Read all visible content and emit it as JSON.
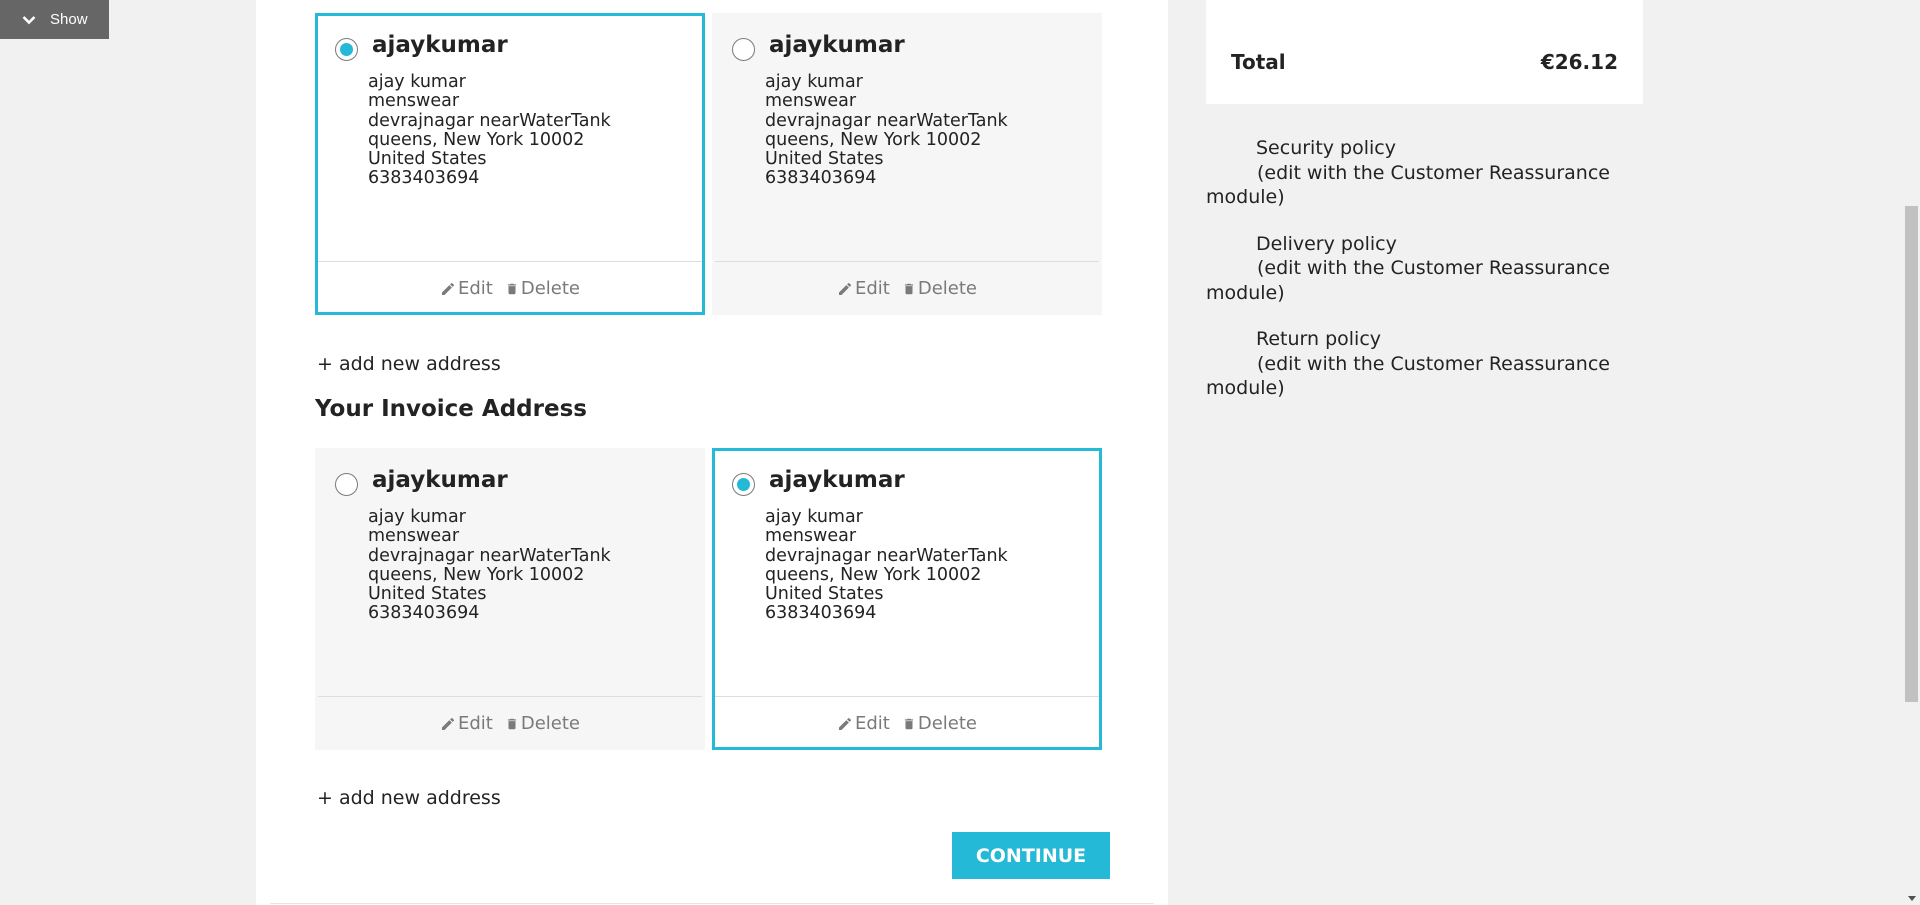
{
  "toggle": {
    "label": "Show"
  },
  "delivery_addresses": [
    {
      "alias": "ajaykumar",
      "selected": true,
      "lines": [
        "ajay kumar",
        "menswear",
        "devrajnagar nearWaterTank",
        "queens, New York 10002",
        "United States",
        "6383403694"
      ],
      "edit_label": "Edit",
      "delete_label": "Delete"
    },
    {
      "alias": "ajaykumar",
      "selected": false,
      "lines": [
        "ajay kumar",
        "menswear",
        "devrajnagar nearWaterTank",
        "queens, New York 10002",
        "United States",
        "6383403694"
      ],
      "edit_label": "Edit",
      "delete_label": "Delete"
    }
  ],
  "add_new_address_label": "+ add new address",
  "invoice_section_title": "Your Invoice Address",
  "invoice_addresses": [
    {
      "alias": "ajaykumar",
      "selected": false,
      "lines": [
        "ajay kumar",
        "menswear",
        "devrajnagar nearWaterTank",
        "queens, New York 10002",
        "United States",
        "6383403694"
      ],
      "edit_label": "Edit",
      "delete_label": "Delete"
    },
    {
      "alias": "ajaykumar",
      "selected": true,
      "lines": [
        "ajay kumar",
        "menswear",
        "devrajnagar nearWaterTank",
        "queens, New York 10002",
        "United States",
        "6383403694"
      ],
      "edit_label": "Edit",
      "delete_label": "Delete"
    }
  ],
  "continue_label": "CONTINUE",
  "summary": {
    "total_label": "Total",
    "total_value": "€26.12"
  },
  "reassurance": [
    {
      "title": "Security policy",
      "sub": "(edit with the Customer Reassurance module)"
    },
    {
      "title": "Delivery policy",
      "sub": "(edit with the Customer Reassurance module)"
    },
    {
      "title": "Return policy",
      "sub": "(edit with the Customer Reassurance module)"
    }
  ],
  "colors": {
    "accent": "#24b9d7",
    "toggle_bg": "#666666",
    "card_bg": "#f6f6f6",
    "page_bg": "#f1f1f1"
  }
}
